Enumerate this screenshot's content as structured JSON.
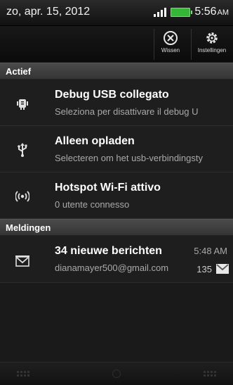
{
  "status_bar": {
    "date": "zo, apr. 15, 2012",
    "time": "5:56",
    "ampm": "AM",
    "battery_color": "#35b637"
  },
  "action_bar": {
    "clear_label": "Wissen",
    "clear_icon": "close-circle-icon",
    "settings_label": "Instellingen",
    "settings_icon": "gear-icon"
  },
  "sections": {
    "active": "Actief",
    "notifications": "Meldingen"
  },
  "active_items": [
    {
      "icon": "android-debug-icon",
      "title": "Debug USB collegato",
      "subtitle": "Seleziona per disattivare il debug U"
    },
    {
      "icon": "usb-icon",
      "title": "Alleen opladen",
      "subtitle": "Selecteren om het usb-verbindingsty"
    },
    {
      "icon": "hotspot-icon",
      "title": "Hotspot Wi-Fi attivo",
      "subtitle": "0 utente connesso"
    }
  ],
  "notifications": [
    {
      "icon": "gmail-icon",
      "title": "34 nieuwe berichten",
      "time": "5:48 AM",
      "subtitle": "dianamayer500@gmail.com",
      "count": "135"
    }
  ]
}
